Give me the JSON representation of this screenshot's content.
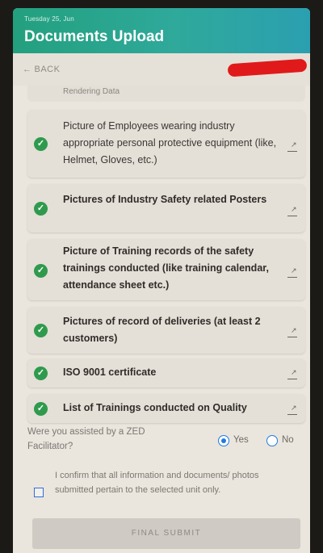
{
  "header": {
    "date": "Tuesday 25, Jun",
    "title": "Documents Upload"
  },
  "nav": {
    "back_label": "BACK",
    "back_arrow": "←"
  },
  "partial_item": {
    "label": "Rendering Data"
  },
  "documents": [
    {
      "label": "Picture of Employees wearing industry appropriate personal protective equipment (like, Helmet, Gloves, etc.)",
      "status": "uploaded",
      "icon": "check-icon"
    },
    {
      "label": "Pictures of Industry Safety related Posters",
      "status": "uploaded",
      "icon": "check-icon"
    },
    {
      "label": "Picture of Training records of the safety trainings conducted (like training calendar, attendance sheet etc.)",
      "status": "uploaded",
      "icon": "check-icon"
    },
    {
      "label": "Pictures of record of deliveries (at least 2 customers)",
      "status": "uploaded",
      "icon": "check-icon"
    },
    {
      "label": "ISO 9001 certificate",
      "status": "uploaded",
      "icon": "check-icon"
    },
    {
      "label": "List of Trainings conducted on Quality",
      "status": "uploaded",
      "icon": "check-icon"
    }
  ],
  "facilitator": {
    "question": "Were you assisted by a ZED Facilitator?",
    "options": [
      "Yes",
      "No"
    ],
    "selected": "Yes"
  },
  "confirmation": {
    "text": "I confirm that all information and documents/ photos submitted pertain to the selected unit only.",
    "checked": false
  },
  "submit_label": "FINAL SUBMIT",
  "colors": {
    "header_start": "#23a07e",
    "header_end": "#2b9fb0",
    "check": "#2f9a4d",
    "radio": "#1f7be0"
  }
}
